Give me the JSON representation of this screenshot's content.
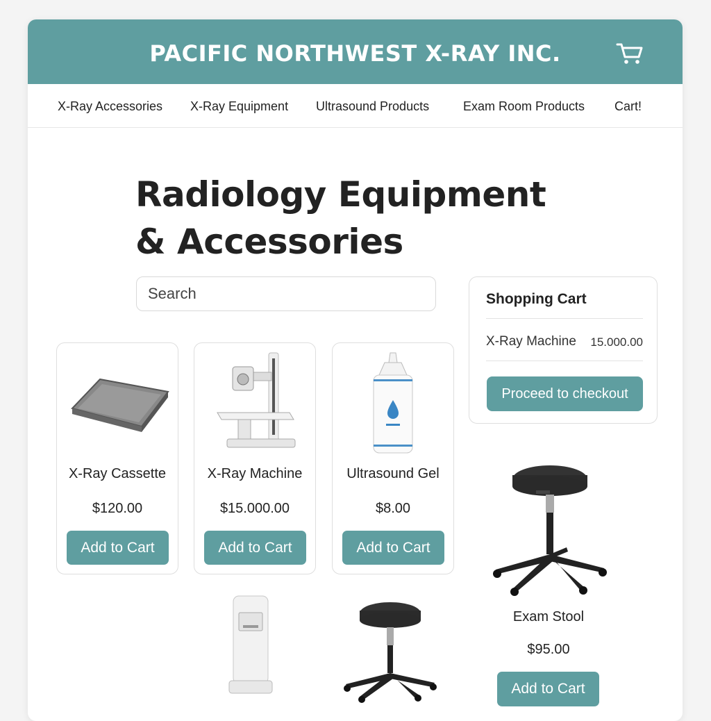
{
  "header": {
    "site_title": "PACIFIC NORTHWEST X-RAY INC."
  },
  "nav": {
    "items": [
      "X-Ray Accessories",
      "X-Ray Equipment",
      "Ultrasound Products",
      "Exam Room Products",
      "Cart!"
    ]
  },
  "page": {
    "title_line1": "Radiology Equipment",
    "title_line2": "& Accessories"
  },
  "search": {
    "placeholder": "Search",
    "value": ""
  },
  "cart": {
    "title": "Shopping Cart",
    "items": [
      {
        "name": "X-Ray Machine",
        "price": "15.000.00"
      }
    ],
    "checkout_label": "Proceed to checkout"
  },
  "products": [
    {
      "name": "X-Ray Cassette",
      "price": "$120.00",
      "button": "Add to Cart"
    },
    {
      "name": "X-Ray Machine",
      "price": "$15.000.00",
      "button": "Add to Cart"
    },
    {
      "name": "Ultrasound Gel",
      "price": "$8.00",
      "button": "Add to Cart"
    },
    {
      "name": "Exam Stool",
      "price": "$95.00",
      "button": "Add to Cart"
    }
  ],
  "colors": {
    "accent": "#5f9ea0",
    "background": "#f4f4f4",
    "card_border": "#dedede"
  },
  "icons": [
    "cart-icon",
    "x-ray-cassette-image",
    "x-ray-machine-image",
    "ultrasound-gel-image",
    "exam-stool-image",
    "cabinet-image"
  ]
}
